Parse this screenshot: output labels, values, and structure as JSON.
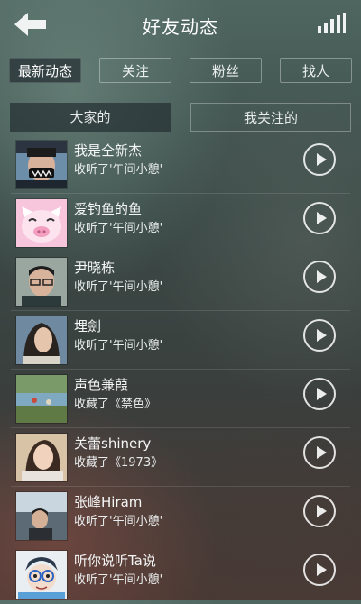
{
  "header": {
    "title": "好友动态",
    "back_icon": "back-arrow-icon",
    "signal_icon": "signal-bars-icon"
  },
  "primary_tabs": [
    {
      "label": "最新动态",
      "active": true
    },
    {
      "label": "关注",
      "active": false
    },
    {
      "label": "粉丝",
      "active": false
    },
    {
      "label": "找人",
      "active": false
    }
  ],
  "secondary_tabs": [
    {
      "label": "大家的",
      "active": true
    },
    {
      "label": "我关注的",
      "active": false
    }
  ],
  "feed": [
    {
      "name": "我是仝新杰",
      "action": "收听了'午间小憩'"
    },
    {
      "name": "爱钓鱼的鱼",
      "action": "收听了'午间小憩'"
    },
    {
      "name": "尹晓栋",
      "action": "收听了'午间小憩'"
    },
    {
      "name": "埋劍",
      "action": "收听了'午间小憩'"
    },
    {
      "name": "声色兼葭",
      "action": "收藏了《禁色》"
    },
    {
      "name": "关蕾shinery",
      "action": "收藏了《1973》"
    },
    {
      "name": "张峰Hiram",
      "action": "收听了'午间小憩'"
    },
    {
      "name": "听你说听Ta说",
      "action": "收听了'午间小憩'"
    }
  ]
}
